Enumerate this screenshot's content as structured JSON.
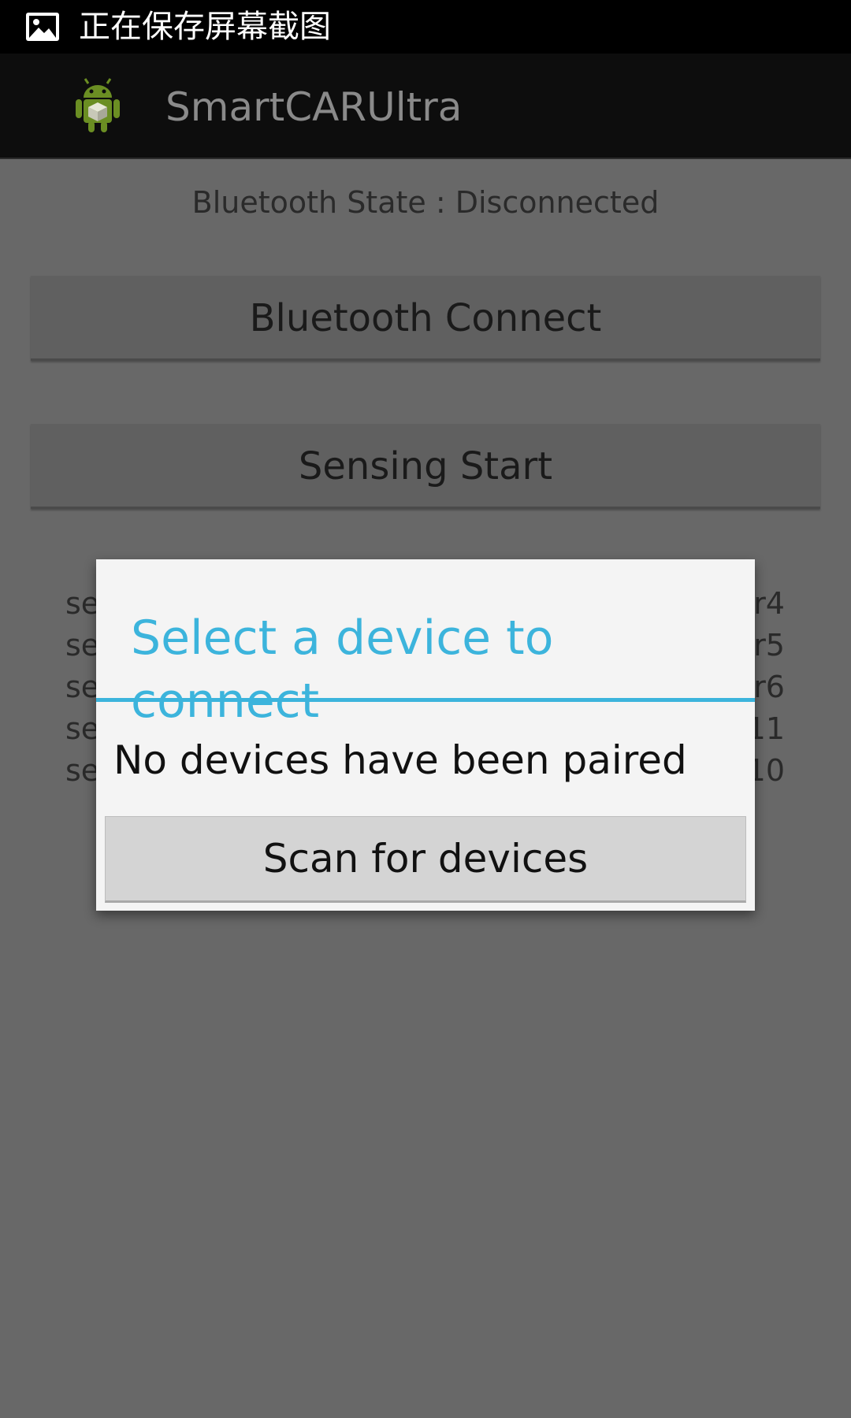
{
  "status_bar": {
    "notification_text": "正在保存屏幕截图",
    "icon": "image-icon"
  },
  "action_bar": {
    "app_icon": "android-icon",
    "title": "SmartCARUltra"
  },
  "main": {
    "bluetooth_state": "Bluetooth State : Disconnected",
    "connect_button": "Bluetooth Connect",
    "sensing_button": "Sensing Start",
    "sensor_rows": [
      {
        "left": "se",
        "right": "r4"
      },
      {
        "left": "se",
        "right": "r5"
      },
      {
        "left": "se",
        "right": "r6"
      },
      {
        "left": "se",
        "right": "11"
      },
      {
        "left": "se",
        "right": "10"
      }
    ]
  },
  "dialog": {
    "title": "Select a device to connect",
    "message": "No devices have been paired",
    "scan_button": "Scan for devices",
    "accent_color": "#3cb4dc"
  }
}
